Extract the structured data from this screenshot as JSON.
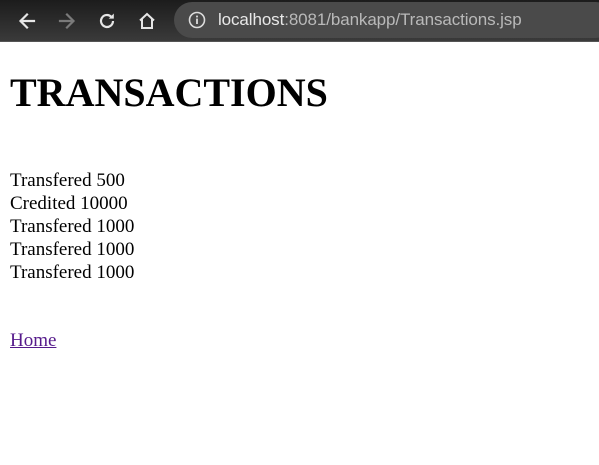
{
  "browser": {
    "url_host": "localhost",
    "url_path": ":8081/bankapp/Transactions.jsp",
    "icons": {
      "back": "arrow-left-icon",
      "forward": "arrow-right-icon",
      "reload": "reload-icon",
      "home": "home-icon",
      "info": "info-icon"
    }
  },
  "page": {
    "title": "TRANSACTIONS",
    "transactions": [
      "Transfered 500",
      "Credited 10000",
      "Transfered 1000",
      "Transfered 1000",
      "Transfered 1000"
    ],
    "home_link": "Home"
  },
  "colors": {
    "visited_link": "#551a8b",
    "toolbar_bg": "#2b2b2b",
    "omnibox_bg": "#4a4a4a"
  }
}
